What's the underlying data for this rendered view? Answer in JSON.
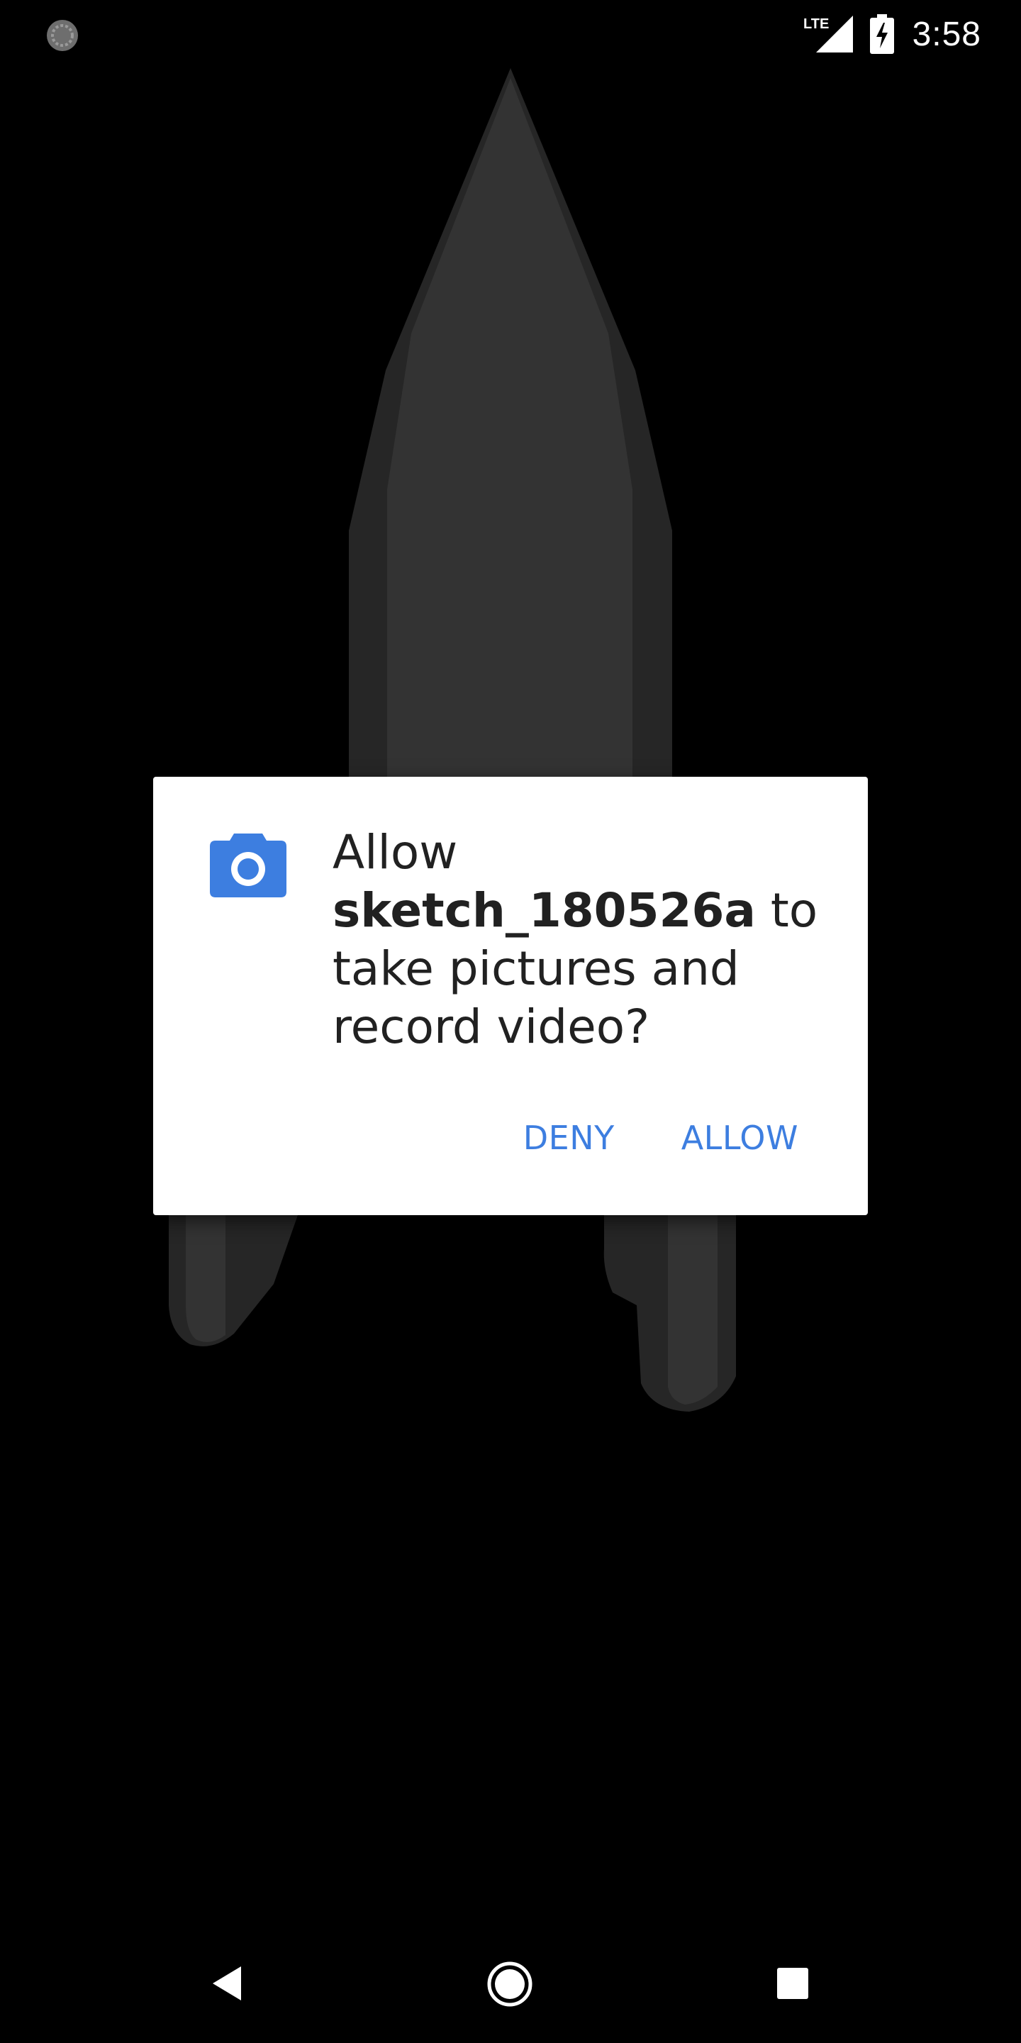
{
  "status_bar": {
    "time": "3:58",
    "network_label": "LTE",
    "icons": [
      "sync-icon",
      "lte-signal-icon",
      "battery-charging-icon"
    ]
  },
  "dialog": {
    "icon": "camera-icon",
    "prefix": "Allow",
    "app_name": "sketch_180526a",
    "suffix": "to take pictures and record video?",
    "deny_label": "DENY",
    "allow_label": "ALLOW"
  },
  "nav_bar": {
    "icons": [
      "back-icon",
      "home-icon",
      "recents-icon"
    ]
  },
  "colors": {
    "accent": "#3D7EE0",
    "dialog_bg": "#FFFFFF",
    "text": "#212121",
    "screen_bg": "#000000",
    "rocket_dark": "#262626",
    "rocket_light": "#333333"
  }
}
